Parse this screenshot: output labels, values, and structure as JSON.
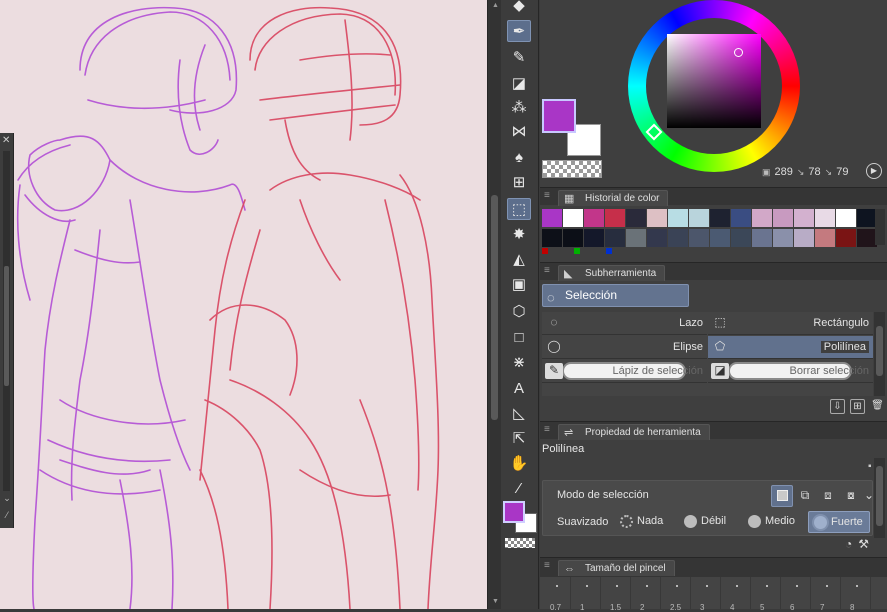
{
  "colors": {
    "main": "#a936c6",
    "sub": "#ffffff",
    "canvas_bg": "#ecdde0",
    "accent": "#61718d"
  },
  "color_readout": {
    "h": "289",
    "s": "78",
    "v": "79"
  },
  "panels": {
    "color_history": "Historial de color",
    "subtool": "Subherramienta",
    "tool_property": "Propiedad de herramienta",
    "brush_size": "Tamaño del pincel"
  },
  "palette": {
    "row1": [
      "#a936c6",
      "#ffffff",
      "#c2368a",
      "#c62f4a",
      "#2a2a3a",
      "#ddc0c4",
      "#b8dde4",
      "#b9d4dc",
      "#1e2230",
      "#3a4d82",
      "#d2a8c8",
      "#c89ac0",
      "#d3b1cf",
      "#e8dae6",
      "#ffffff",
      "#0e1420"
    ],
    "row2": [
      "#0d1018",
      "#0c0f17",
      "#14182a",
      "#272d3e",
      "#6a7278",
      "#33384d",
      "#3a4356",
      "#4c566b",
      "#4b5a72",
      "#3b4758",
      "#6a7490",
      "#8a90aa",
      "#b8acc6",
      "#c47a7f",
      "#7a1414",
      "#20141a"
    ],
    "marks": [
      "#c00000",
      "#00b000",
      "#0030d0"
    ]
  },
  "subtool": {
    "group": "Selección",
    "items": [
      {
        "label": "Lazo",
        "icon": "lasso-icon"
      },
      {
        "label": "Rectángulo",
        "icon": "rectangle-select-icon"
      },
      {
        "label": "Elipse",
        "icon": "ellipse-select-icon"
      },
      {
        "label": "Polilínea",
        "icon": "polyline-select-icon",
        "selected": true
      },
      {
        "label": "Lápiz de selección",
        "icon": "selection-pen-icon"
      },
      {
        "label": "Borrar selección",
        "icon": "selection-eraser-icon"
      }
    ]
  },
  "tool_property": {
    "name": "Polilínea",
    "mode_label": "Modo de selección",
    "smooth_label": "Suavizado",
    "smooth_options": [
      "Nada",
      "Débil",
      "Medio",
      "Fuerte"
    ],
    "smooth_selected": "Fuerte"
  },
  "brush_size_labels": [
    "0.7",
    "1",
    "1.5",
    "2",
    "2.5",
    "3",
    "4",
    "5",
    "6",
    "7",
    "8"
  ]
}
